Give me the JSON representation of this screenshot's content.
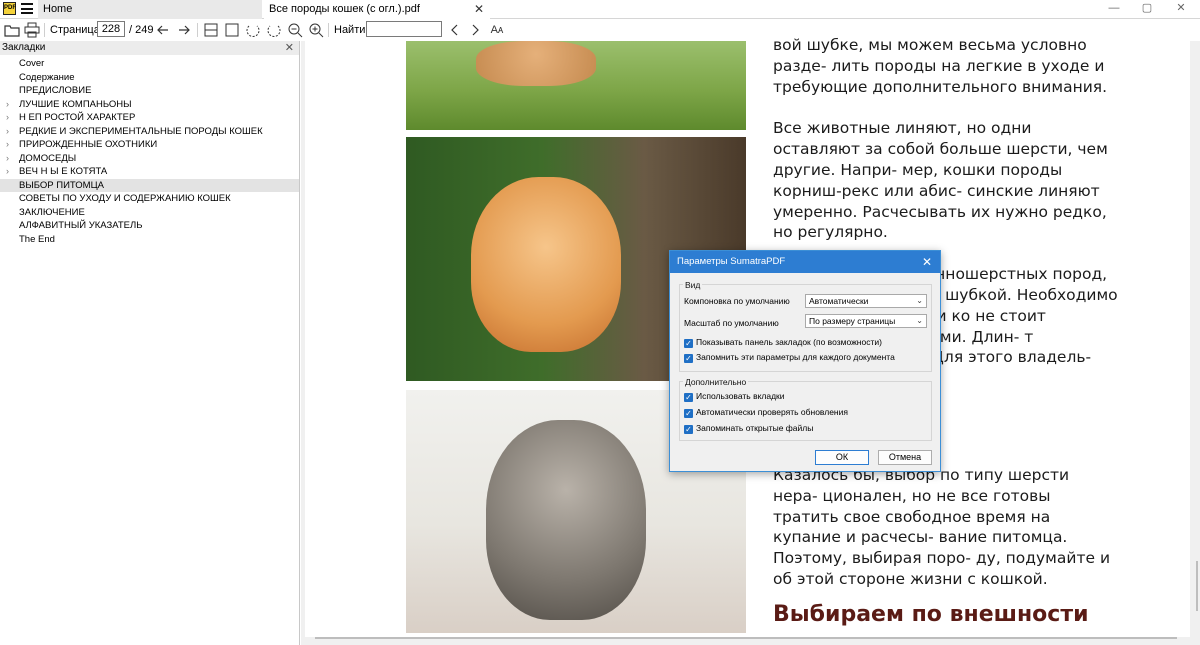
{
  "tabs": [
    {
      "label": "Home"
    },
    {
      "label": "Все породы кошек (с огл.).pdf",
      "close": "✕"
    }
  ],
  "app_logo_text": "PDF",
  "window_controls": {
    "minimize": "—",
    "maximize": "▢",
    "close": "✕"
  },
  "toolbar": {
    "page_label": "Страница:",
    "page_current": "228",
    "page_total": "/ 249",
    "find_label": "Найти:",
    "find_value": "",
    "font_icon_glyph": "Aᴀ"
  },
  "sidebar": {
    "title": "Закладки",
    "close": "✕",
    "items": [
      {
        "label": "Cover",
        "expandable": false,
        "selected": false
      },
      {
        "label": "Содержание",
        "expandable": false,
        "selected": false
      },
      {
        "label": "ПРЕДИСЛОВИЕ",
        "expandable": false,
        "selected": false
      },
      {
        "label": "ЛУЧШИЕ КОМПАНЬОНЫ",
        "expandable": true,
        "selected": false
      },
      {
        "label": "Н ЕП РОСТОЙ ХАРАКТЕР",
        "expandable": true,
        "selected": false
      },
      {
        "label": "РЕДКИЕ И ЭКСПЕРИМЕНТАЛЬНЫЕ ПОРОДЫ КОШЕК",
        "expandable": true,
        "selected": false
      },
      {
        "label": "ПРИРОЖДЕННЫЕ ОХОТНИКИ",
        "expandable": true,
        "selected": false
      },
      {
        "label": "ДОМОСЕДЫ",
        "expandable": true,
        "selected": false
      },
      {
        "label": "ВЕЧ Н Ы Е КОТЯТА",
        "expandable": true,
        "selected": false
      },
      {
        "label": "ВЫБОР ПИТОМЦА",
        "expandable": false,
        "selected": true
      },
      {
        "label": "СОВЕТЫ ПО УХОДУ И СОДЕРЖАНИЮ КОШЕК",
        "expandable": false,
        "selected": false
      },
      {
        "label": "ЗАКЛЮЧЕНИЕ",
        "expandable": false,
        "selected": false
      },
      {
        "label": "АЛФАВИТНЫЙ УКАЗАТЕЛЬ",
        "expandable": false,
        "selected": false
      },
      {
        "label": "The End",
        "expandable": false,
        "selected": false
      }
    ]
  },
  "document": {
    "paragraphs": [
      "вой шубке, мы можем весьма условно разде- лить породы на легкие в уходе и требующие дополнительного внимания.",
      "Все животные линяют, но одни оставляют за собой больше шерсти, чем другие. Напри- мер, кошки породы корниш-рекс или абис- синские линяют умеренно. Расчесывать их нужно редко, но регулярно.",
      "Представители длинношерстных пород, я в дополнительном шубкой. Необходимо альными шампунями ко не стоит слишком процедурами. Длин- т регулярно и тща- . Для этого владель- специальные щетки",
      "Казалось бы, выбор по типу шерсти нера- ционален, но не все готовы тратить свое свободное время на купание и расчесы- вание питомца. Поэтому, выбирая поро- ду, подумайте и об этой стороне жизни с кошкой."
    ],
    "heading": "Выбираем по внешности"
  },
  "dialog": {
    "title": "Параметры SumatraPDF",
    "close": "✕",
    "group_view": "Вид",
    "layout_label": "Компоновка по умолчанию",
    "layout_value": "Автоматически",
    "zoom_label": "Масштаб по умолчанию",
    "zoom_value": "По размеру страницы",
    "chk_show_bookmarks": "Показывать панель закладок (по возможности)",
    "chk_remember_params": "Запомнить эти параметры для каждого документа",
    "group_extra": "Дополнительно",
    "chk_use_tabs": "Использовать вкладки",
    "chk_auto_update": "Автоматически проверять обновления",
    "chk_remember_files": "Запоминать открытые файлы",
    "ok": "ОК",
    "cancel": "Отмена",
    "check_glyph": "✓",
    "caret": "⌄"
  },
  "colors": {
    "dialog_title_bar": "#2d7dd2",
    "checkbox": "#1f6fc5",
    "heading": "#5a1b15",
    "selected_bookmark": "#e3e3e3"
  }
}
